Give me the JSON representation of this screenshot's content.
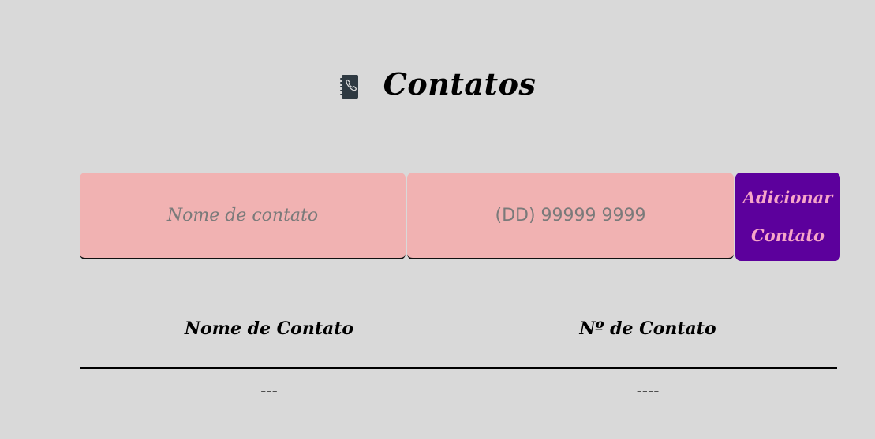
{
  "header": {
    "title": "Contatos",
    "icon": "address-book-icon"
  },
  "form": {
    "name_placeholder": "Nome de contato",
    "phone_placeholder": "(DD) 99999 9999",
    "add_button_label": "Adicionar Contato"
  },
  "table": {
    "columns": [
      "Nome de Contato",
      "Nº de Contato"
    ],
    "rows": [
      [
        "---",
        "----"
      ]
    ]
  },
  "colors": {
    "background": "#d9d9d9",
    "input_background": "#f1b2b2",
    "button_background": "#5c009c",
    "button_text": "#f6a6c8"
  }
}
